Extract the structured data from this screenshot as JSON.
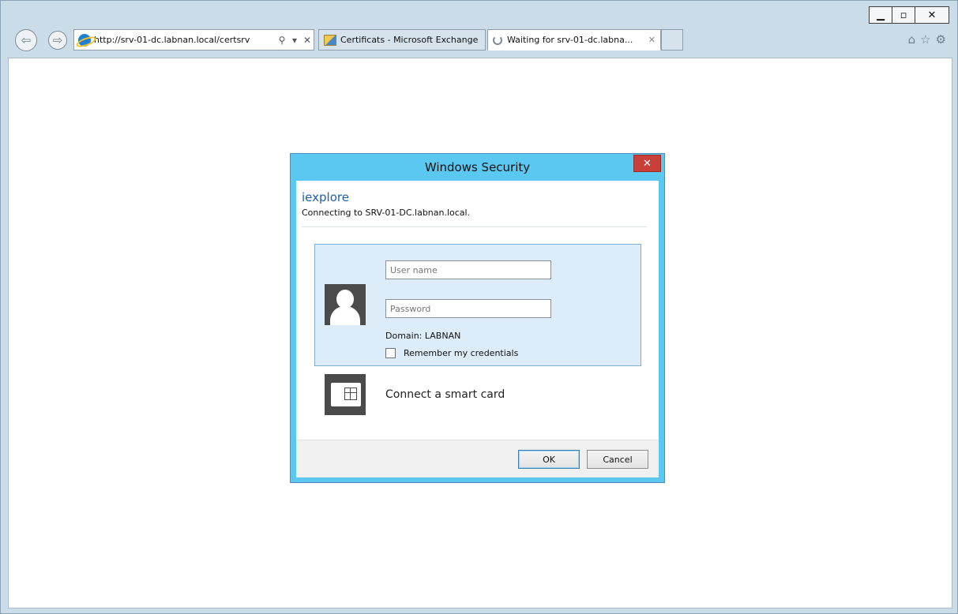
{
  "browser": {
    "address_url": "http://srv-01-dc.labnan.local/certsrv",
    "tabs": [
      {
        "label": "Certificats - Microsoft Exchange"
      },
      {
        "label": "Waiting for srv-01-dc.labna..."
      }
    ]
  },
  "dialog": {
    "title": "Windows Security",
    "app_name": "iexplore",
    "connecting_text": "Connecting to SRV-01-DC.labnan.local.",
    "username_placeholder": "User name",
    "password_placeholder": "Password",
    "domain_text": "Domain: LABNAN",
    "remember_label": "Remember my credentials",
    "smart_card_label": "Connect a smart card",
    "ok_label": "OK",
    "cancel_label": "Cancel"
  },
  "colors": {
    "dialog_frame": "#5ac8f0",
    "close_button": "#c9403a",
    "credential_panel": "#dcecf8",
    "app_name_text": "#1f5fa8"
  }
}
